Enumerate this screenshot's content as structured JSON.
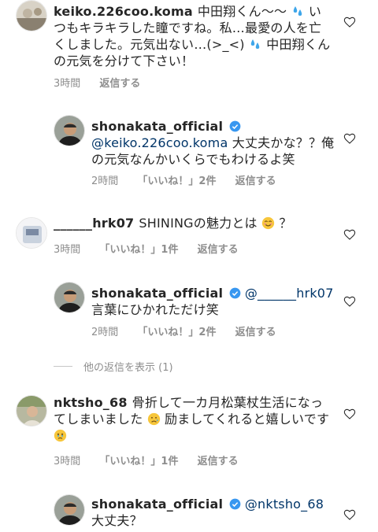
{
  "comments": [
    {
      "username": "keiko.226coo.koma",
      "text_before": "中田翔くん〜〜",
      "text_after": "いつもキラキラした瞳ですね。私…最愛の人を亡くしました。元気出ない…(>_<)",
      "text_end": "中田翔くんの元気を分けて下さい！",
      "time": "3時間",
      "reply": "返信する"
    },
    {
      "username": "shonakata_official",
      "mention": "@keiko.226coo.koma",
      "text": "大丈夫かな？？俺の元気なんかいくらでもわけるよ笑",
      "time": "2時間",
      "likes": "「いいね！」2件",
      "reply": "返信する"
    },
    {
      "username": "______hrk07",
      "text_before": "SHININGの魅力とは",
      "text_after": "？",
      "time": "3時間",
      "likes": "「いいね！」1件",
      "reply": "返信する"
    },
    {
      "username": "shonakata_official",
      "mention": "@______hrk07",
      "text": "言葉にひかれただけ笑",
      "time": "2時間",
      "likes": "「いいね！」2件",
      "reply": "返信する"
    },
    {
      "username": "nktsho_68",
      "text_before": "骨折して一カ月松葉杖生活になってしまいました",
      "text_mid": "励ましてくれると嬉しいです",
      "time": "3時間",
      "likes": "「いいね！」1件",
      "reply": "返信する"
    },
    {
      "username": "shonakata_official",
      "mention": "@nktsho_68",
      "text": "大丈夫？"
    }
  ],
  "more_replies": "他の返信を表示 (1)",
  "colors": {
    "mention": "#003569",
    "verified": "#3897f0",
    "meta": "#8e8e8e"
  }
}
